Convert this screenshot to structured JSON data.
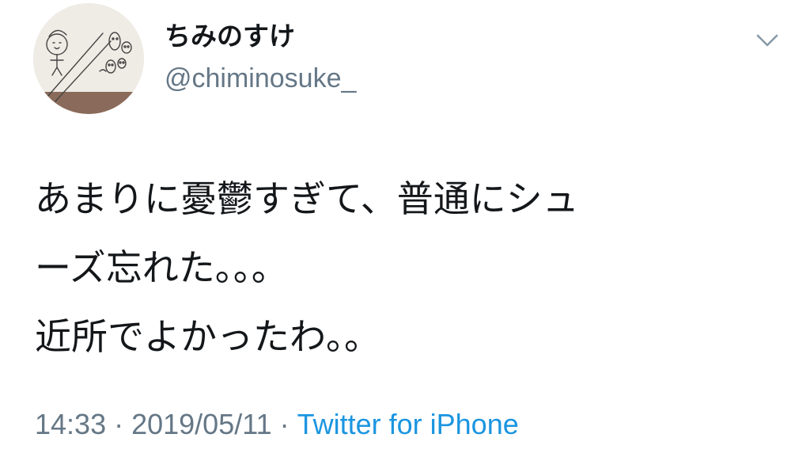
{
  "tweet": {
    "display_name": "ちみのすけ",
    "handle": "@chiminosuke_",
    "body_lines": [
      "あまりに憂鬱すぎて、普通にシュ",
      "ーズ忘れた。。。",
      "近所でよかったわ。。"
    ],
    "time": "14:33",
    "separator": "·",
    "date": "2019/05/11",
    "source": "Twitter for iPhone"
  },
  "icons": {
    "avatar": "avatar-sketch-illustration",
    "menu": "chevron-down-icon"
  },
  "colors": {
    "text": "#14171a",
    "secondary": "#657786",
    "link": "#1b95e0",
    "background": "#ffffff"
  }
}
